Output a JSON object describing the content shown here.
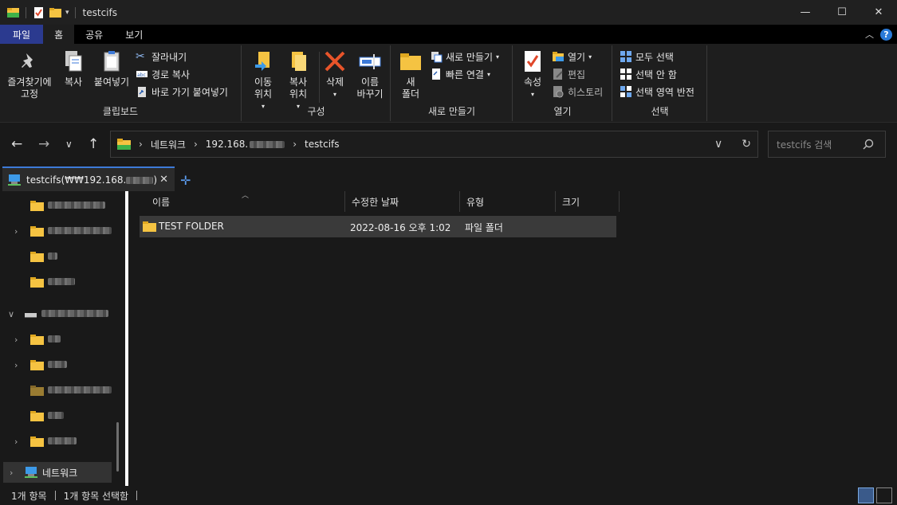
{
  "window": {
    "title": "testcifs",
    "controls": [
      "minimize-icon",
      "maximize-icon",
      "close-icon"
    ]
  },
  "ribbon_tabs": [
    {
      "label": "파일",
      "active": false
    },
    {
      "label": "홈",
      "active": true
    },
    {
      "label": "공유",
      "active": false
    },
    {
      "label": "보기",
      "active": false
    }
  ],
  "ribbon": {
    "clipboard": {
      "label": "클립보드",
      "pin": "즐겨찾기에\n고정",
      "copy": "복사",
      "paste": "붙여넣기",
      "cut": "잘라내기",
      "copy_path": "경로 복사",
      "paste_shortcut": "바로 가기 붙여넣기"
    },
    "organize": {
      "label": "구성",
      "move_to": "이동\n위치",
      "copy_to": "복사\n위치",
      "delete": "삭제",
      "rename": "이름\n바꾸기"
    },
    "new": {
      "label": "새로 만들기",
      "new_folder": "새\n폴더",
      "new_item": "새로 만들기",
      "easy_access": "빠른 연결"
    },
    "open": {
      "label": "열기",
      "properties": "속성",
      "open": "열기",
      "edit": "편집",
      "history": "히스토리"
    },
    "select": {
      "label": "선택",
      "select_all": "모두 선택",
      "select_none": "선택 안 함",
      "invert": "선택 영역 반전"
    }
  },
  "address": {
    "crumbs": [
      "네트워크",
      "192.168.",
      "testcifs"
    ],
    "search_placeholder": "testcifs 검색"
  },
  "tab": {
    "title": "testcifs(₩₩192.168.",
    "title_suffix": ")"
  },
  "tree": {
    "network_label": "네트워크"
  },
  "columns": [
    "이름",
    "수정한 날짜",
    "유형",
    "크기"
  ],
  "files": [
    {
      "name": "TEST FOLDER",
      "modified": "2022-08-16 오후 1:02",
      "type": "파일 폴더",
      "size": ""
    }
  ],
  "status": {
    "count": "1개 항목",
    "selected": "1개 항목 선택함"
  },
  "colors": {
    "file_tab": "#2b3a8f",
    "accent": "#3d7ad8",
    "folder": "#f5c342"
  }
}
